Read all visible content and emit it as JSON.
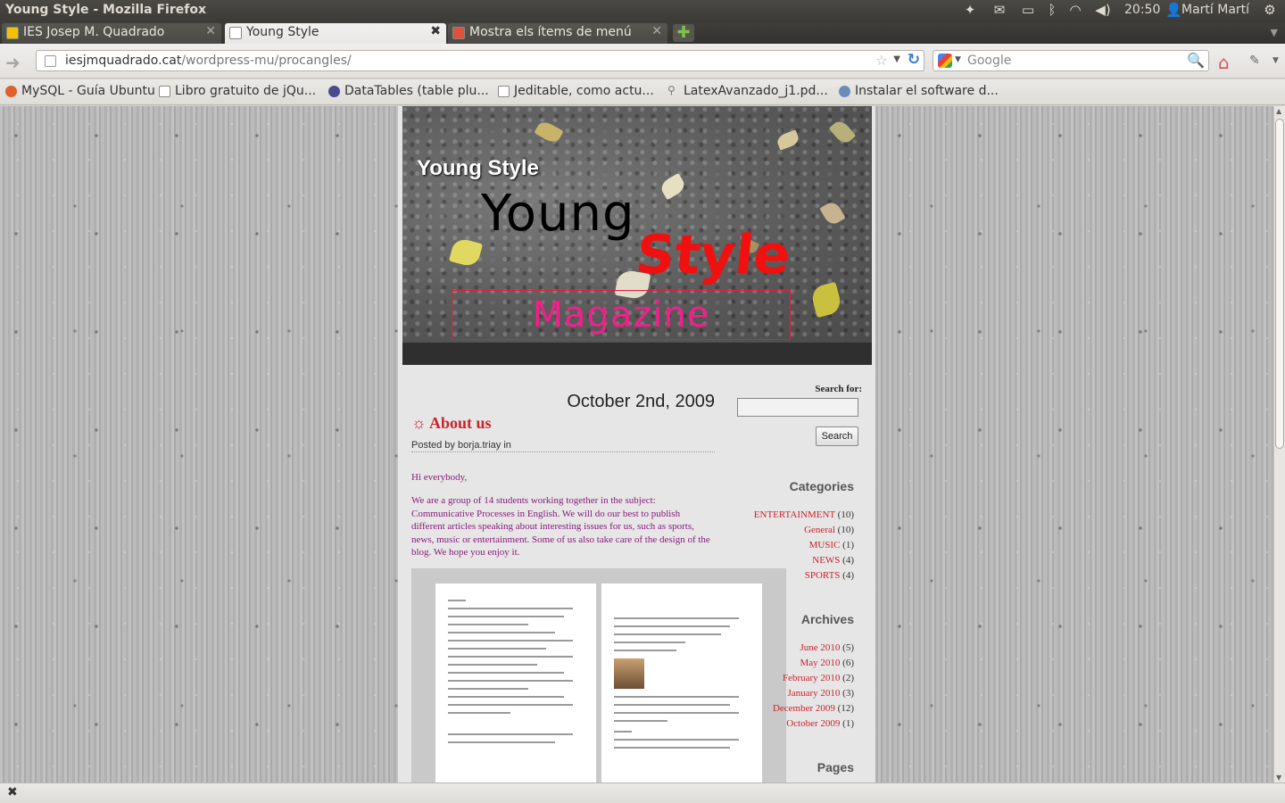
{
  "window": {
    "title": "Young Style - Mozilla Firefox"
  },
  "panel": {
    "clock": "20:50",
    "user": "Martí Martí"
  },
  "tabs": [
    {
      "label": "IES Josep M. Quadrado",
      "active": false
    },
    {
      "label": "Young Style",
      "active": true
    },
    {
      "label": "Mostra els ítems de menú",
      "active": false
    }
  ],
  "navbar": {
    "url_host": "iesjmquadrado.cat",
    "url_path": "/wordpress-mu/procangles/",
    "search_placeholder": "Google"
  },
  "bookmarks": [
    {
      "label": "MySQL - Guía Ubuntu",
      "icon": "ubuntu-icon"
    },
    {
      "label": "Libro gratuito de jQu...",
      "icon": "page-icon"
    },
    {
      "label": "DataTables (table plu...",
      "icon": "datatables-icon"
    },
    {
      "label": "Jeditable, como actu...",
      "icon": "page-icon"
    },
    {
      "label": "LatexAvanzado_j1.pd...",
      "icon": "pdf-icon"
    },
    {
      "label": "Instalar el software d...",
      "icon": "software-icon"
    }
  ],
  "blog": {
    "title": "Young Style",
    "logo": {
      "young": "Young",
      "style": "Style",
      "magazine": "Magazine"
    }
  },
  "post": {
    "date": "October 2nd, 2009",
    "title": "About us",
    "title_icon": "sun-icon",
    "meta": "Posted by borja.triay in",
    "greeting": "Hi everybody,",
    "body": "We are a group of 14 students working together in the subject: Communicative Processes in English. We will do our best to publish different articles speaking about interesting issues for us, such as sports, news, music or entertainment. Some of us also take care of the design of the blog. We hope you enjoy it."
  },
  "sidebar": {
    "search_label": "Search for:",
    "search_button": "Search",
    "categories_title": "Categories",
    "categories": [
      {
        "name": "ENTERTAINMENT",
        "count": "(10)"
      },
      {
        "name": "General",
        "count": "(10)"
      },
      {
        "name": "MUSIC",
        "count": "(1)"
      },
      {
        "name": "NEWS",
        "count": "(4)"
      },
      {
        "name": "SPORTS",
        "count": "(4)"
      }
    ],
    "archives_title": "Archives",
    "archives": [
      {
        "name": "June 2010",
        "count": "(5)"
      },
      {
        "name": "May 2010",
        "count": "(6)"
      },
      {
        "name": "February 2010",
        "count": "(2)"
      },
      {
        "name": "January 2010",
        "count": "(3)"
      },
      {
        "name": "December 2009",
        "count": "(12)"
      },
      {
        "name": "October 2009",
        "count": "(1)"
      }
    ],
    "pages_title": "Pages"
  },
  "colors": {
    "link": "#c8242c",
    "post_text": "#8a1a7a",
    "logo_style": "#f01010",
    "logo_magazine": "#f0208a"
  }
}
